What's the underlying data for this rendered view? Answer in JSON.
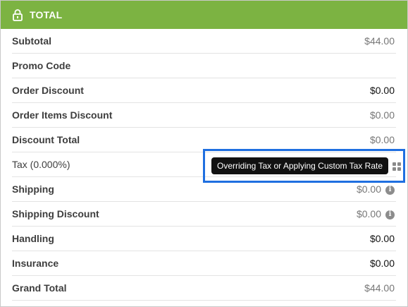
{
  "header": {
    "title": "TOTAL",
    "icon": "lock-icon",
    "bg_color": "#7cb342"
  },
  "rows": [
    {
      "label": "Subtotal",
      "value": "$44.00",
      "value_style": "muted"
    },
    {
      "label": "Promo Code",
      "value": "",
      "value_style": "muted"
    },
    {
      "label": "Order Discount",
      "value": "$0.00",
      "value_style": "dark"
    },
    {
      "label": "Order Items Discount",
      "value": "$0.00",
      "value_style": "muted"
    },
    {
      "label": "Discount Total",
      "value": "$0.00",
      "value_style": "muted"
    },
    {
      "label": "Tax (0.000%)",
      "value": "",
      "value_style": "muted",
      "icon": "grid-icon"
    },
    {
      "label": "Shipping",
      "value": "$0.00",
      "value_style": "muted",
      "icon": "info-icon"
    },
    {
      "label": "Shipping Discount",
      "value": "$0.00",
      "value_style": "muted",
      "icon": "info-icon"
    },
    {
      "label": "Handling",
      "value": "$0.00",
      "value_style": "dark"
    },
    {
      "label": "Insurance",
      "value": "$0.00",
      "value_style": "dark"
    },
    {
      "label": "Grand Total",
      "value": "$44.00",
      "value_style": "muted"
    }
  ],
  "tooltip": {
    "text": "Overriding Tax or Applying Custom Tax Rate"
  },
  "highlight_color": "#1f6fe0"
}
